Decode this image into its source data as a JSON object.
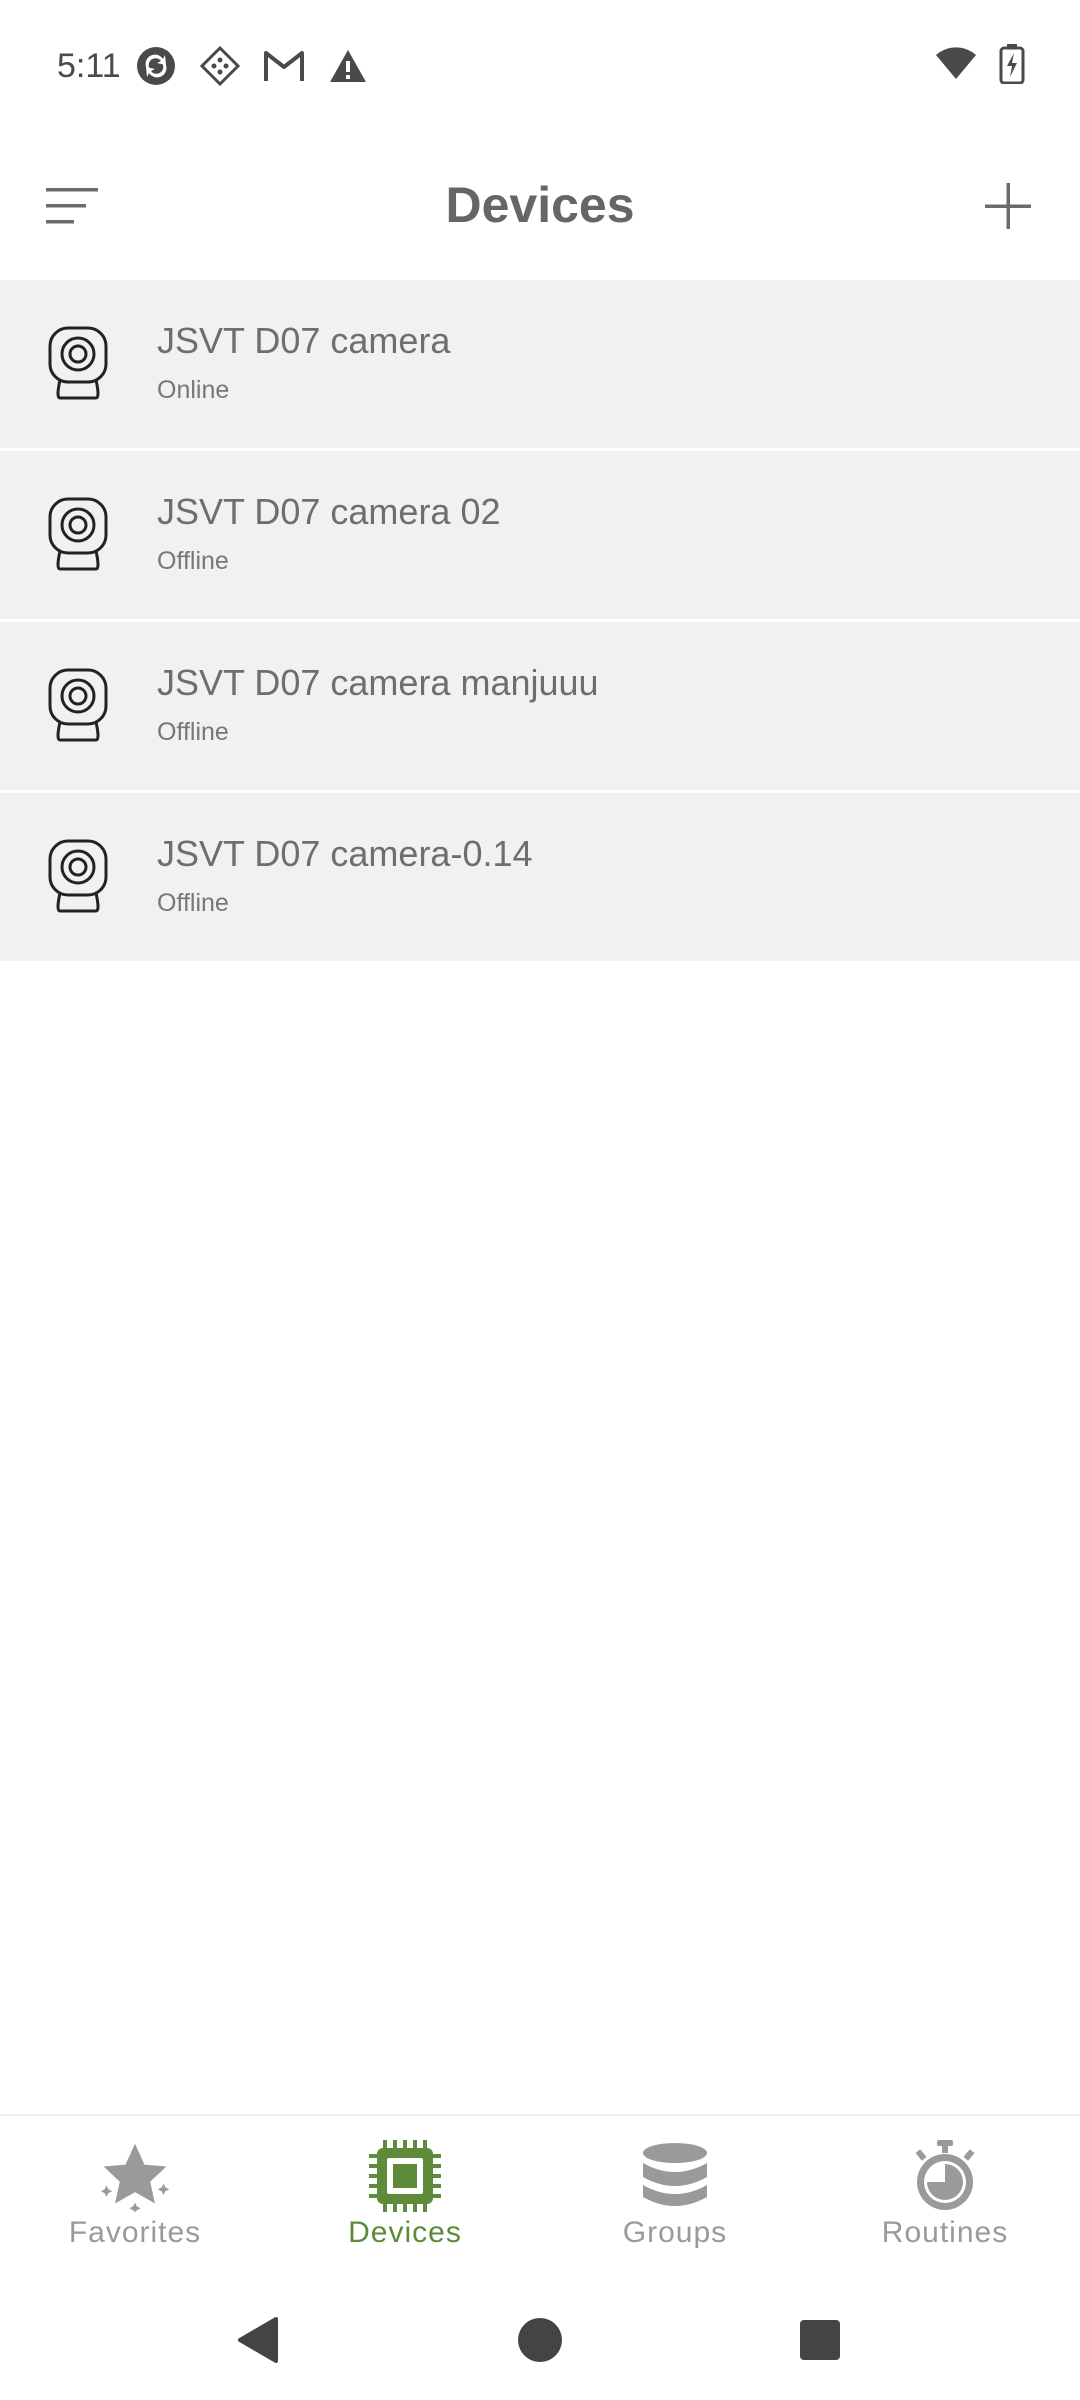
{
  "status_bar": {
    "time": "5:11",
    "left_icons": [
      "sync-icon",
      "vpn-icon",
      "gmail-icon",
      "warning-icon"
    ],
    "right_icons": [
      "wifi-icon",
      "battery-charging-icon"
    ]
  },
  "app_bar": {
    "title": "Devices",
    "menu_icon": "filter-menu-icon",
    "add_icon": "plus-icon"
  },
  "devices": [
    {
      "name": "JSVT D07 camera",
      "status": "Online",
      "icon": "camera-icon"
    },
    {
      "name": "JSVT D07 camera 02",
      "status": "Offline",
      "icon": "camera-icon"
    },
    {
      "name": "JSVT D07 camera manjuuu",
      "status": "Offline",
      "icon": "camera-icon"
    },
    {
      "name": "JSVT D07 camera-0.14",
      "status": "Offline",
      "icon": "camera-icon"
    }
  ],
  "bottom_nav": {
    "active": "Devices",
    "items": [
      {
        "label": "Favorites",
        "icon": "star-icon"
      },
      {
        "label": "Devices",
        "icon": "chip-icon"
      },
      {
        "label": "Groups",
        "icon": "database-icon"
      },
      {
        "label": "Routines",
        "icon": "stopwatch-icon"
      }
    ]
  },
  "colors": {
    "accent": "#5e8a3a",
    "row_background": "#f1f1f1",
    "inactive": "#9a9a9a"
  },
  "system_nav": [
    "back-icon",
    "home-icon",
    "recents-icon"
  ]
}
